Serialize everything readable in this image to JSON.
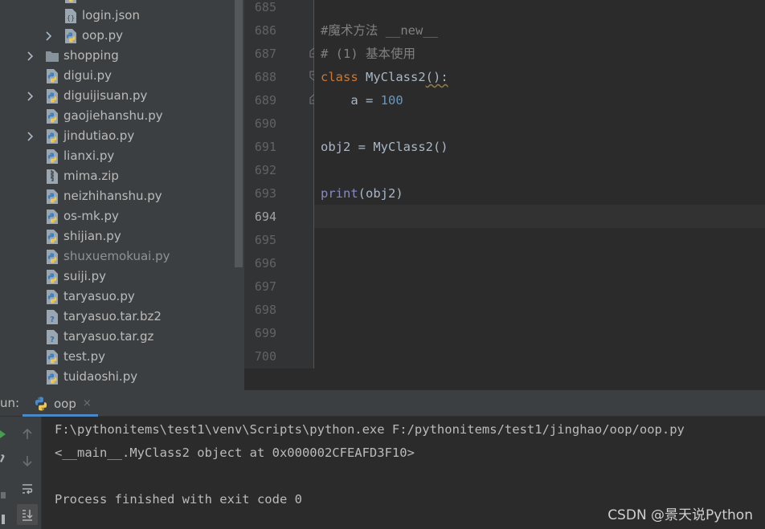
{
  "project_tree": {
    "items": [
      {
        "name": "login.json",
        "icon": "json-file-icon",
        "dim": false,
        "expandable": false
      },
      {
        "name": "oop.py",
        "icon": "python-file-icon",
        "dim": false,
        "expandable": true
      },
      {
        "name": "shopping",
        "icon": "folder-icon",
        "dim": false,
        "expandable": true
      },
      {
        "name": "digui.py",
        "icon": "python-file-icon",
        "dim": false,
        "expandable": false
      },
      {
        "name": "diguijisuan.py",
        "icon": "python-file-icon",
        "dim": false,
        "expandable": true
      },
      {
        "name": "gaojiehanshu.py",
        "icon": "python-file-icon",
        "dim": false,
        "expandable": false
      },
      {
        "name": "jindutiao.py",
        "icon": "python-file-icon",
        "dim": false,
        "expandable": true
      },
      {
        "name": "lianxi.py",
        "icon": "python-file-icon",
        "dim": false,
        "expandable": false
      },
      {
        "name": "mima.zip",
        "icon": "zip-file-icon",
        "dim": false,
        "expandable": false
      },
      {
        "name": "neizhihanshu.py",
        "icon": "python-file-icon",
        "dim": false,
        "expandable": false
      },
      {
        "name": "os-mk.py",
        "icon": "python-file-icon",
        "dim": false,
        "expandable": false
      },
      {
        "name": "shijian.py",
        "icon": "python-file-icon",
        "dim": false,
        "expandable": false
      },
      {
        "name": "shuxuemokuai.py",
        "icon": "python-file-icon",
        "dim": true,
        "expandable": false
      },
      {
        "name": "suiji.py",
        "icon": "python-file-icon",
        "dim": false,
        "expandable": false
      },
      {
        "name": "taryasuo.py",
        "icon": "python-file-icon",
        "dim": false,
        "expandable": false
      },
      {
        "name": "taryasuo.tar.bz2",
        "icon": "unknown-file-icon",
        "dim": false,
        "expandable": false
      },
      {
        "name": "taryasuo.tar.gz",
        "icon": "unknown-file-icon",
        "dim": false,
        "expandable": false
      },
      {
        "name": "test.py",
        "icon": "python-file-icon",
        "dim": false,
        "expandable": false
      },
      {
        "name": "tuidaoshi.py",
        "icon": "python-file-icon",
        "dim": false,
        "expandable": false
      }
    ]
  },
  "editor": {
    "line_numbers": [
      "685",
      "686",
      "687",
      "688",
      "689",
      "690",
      "691",
      "692",
      "693",
      "694",
      "695",
      "696",
      "697",
      "698",
      "699",
      "700"
    ],
    "current_line": "694",
    "code": {
      "l686": "#魔术方法 __new__",
      "l687": "# (1) 基本使用",
      "l688_kw": "class",
      "l688_name": "MyClass2",
      "l688_rest": "():",
      "l689_var": "a",
      "l689_eq": " = ",
      "l689_num": "100",
      "l691": "obj2 = MyClass2()",
      "l693_fn": "print",
      "l693_rest": "(obj2)"
    }
  },
  "run_panel": {
    "label": "un:",
    "tab": {
      "label": "oop",
      "close": "×",
      "icon": "python-file-icon"
    },
    "tools": [
      "arrow-up-icon",
      "arrow-down-icon",
      "soft-wrap-icon",
      "scroll-to-end-icon"
    ],
    "console_lines": [
      "F:\\pythonitems\\test1\\venv\\Scripts\\python.exe F:/pythonitems/test1/jinghao/oop/oop.py",
      "<__main__.MyClass2 object at 0x000002CFEAFD3F10>",
      "",
      "Process finished with exit code 0"
    ]
  },
  "watermark": "CSDN @景天说Python",
  "colors": {
    "tree_bg": "#3c3f41",
    "editor_bg": "#2b2b2b",
    "keyword": "#cc7832",
    "number": "#6897bb",
    "comment": "#808080",
    "builtin": "#8888c6",
    "tab_underline": "#4a88c7"
  }
}
